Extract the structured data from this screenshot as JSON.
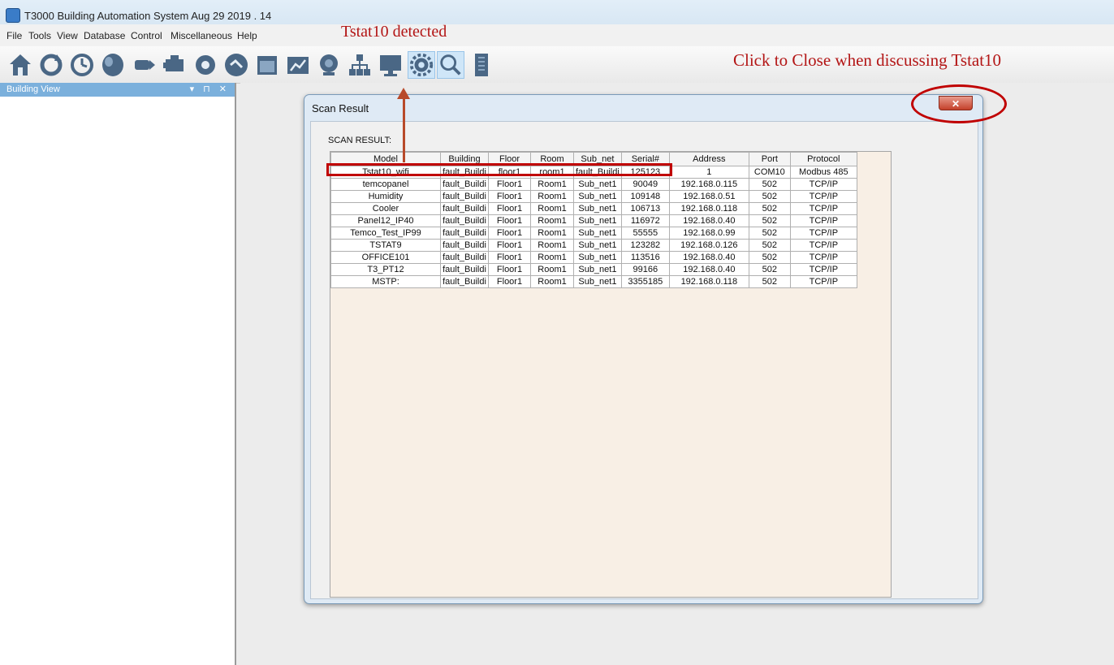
{
  "window": {
    "title": "T3000 Building Automation System   Aug 29 2019  . 14"
  },
  "menu": [
    "File",
    "Tools",
    "View",
    "Database",
    "Control",
    "Miscellaneous",
    "Help"
  ],
  "annotations": {
    "detected": "Tstat10 detected",
    "close_hint": "Click to Close when discussing Tstat10",
    "color": "#b31515"
  },
  "toolbar": {
    "icons": [
      "building-icon",
      "refresh-icon",
      "schedule-icon",
      "input-icon",
      "output-icon",
      "variable-icon",
      "program-icon",
      "controller-icon",
      "calendar-icon",
      "graph-icon",
      "alarm-icon",
      "network-icon",
      "screen-icon",
      "settings-icon",
      "scan-icon",
      "panel-icon"
    ]
  },
  "left_pane": {
    "title": "Building View",
    "controls": "▾ ⊓ ✕"
  },
  "dialog": {
    "title": "Scan Result",
    "close_label": "✕",
    "section_label": "SCAN RESULT:",
    "columns": [
      "Model",
      "Building",
      "Floor",
      "Room",
      "Sub_net",
      "Serial#",
      "Address",
      "Port",
      "Protocol"
    ],
    "rows": [
      [
        "Tstat10_wifi",
        "fault_Buildi",
        "floor1",
        "room1",
        "fault_Buildi",
        "125123",
        "1",
        "COM10",
        "Modbus 485"
      ],
      [
        "temcopanel",
        "fault_Buildi",
        "Floor1",
        "Room1",
        "Sub_net1",
        "90049",
        "192.168.0.115",
        "502",
        "TCP/IP"
      ],
      [
        "Humidity",
        "fault_Buildi",
        "Floor1",
        "Room1",
        "Sub_net1",
        "109148",
        "192.168.0.51",
        "502",
        "TCP/IP"
      ],
      [
        "Cooler",
        "fault_Buildi",
        "Floor1",
        "Room1",
        "Sub_net1",
        "106713",
        "192.168.0.118",
        "502",
        "TCP/IP"
      ],
      [
        "Panel12_IP40",
        "fault_Buildi",
        "Floor1",
        "Room1",
        "Sub_net1",
        "116972",
        "192.168.0.40",
        "502",
        "TCP/IP"
      ],
      [
        "Temco_Test_IP99",
        "fault_Buildi",
        "Floor1",
        "Room1",
        "Sub_net1",
        "55555",
        "192.168.0.99",
        "502",
        "TCP/IP"
      ],
      [
        "TSTAT9",
        "fault_Buildi",
        "Floor1",
        "Room1",
        "Sub_net1",
        "123282",
        "192.168.0.126",
        "502",
        "TCP/IP"
      ],
      [
        "OFFICE101",
        "fault_Buildi",
        "Floor1",
        "Room1",
        "Sub_net1",
        "113516",
        "192.168.0.40",
        "502",
        "TCP/IP"
      ],
      [
        "T3_PT12",
        "fault_Buildi",
        "Floor1",
        "Room1",
        "Sub_net1",
        "99166",
        "192.168.0.40",
        "502",
        "TCP/IP"
      ],
      [
        "MSTP:",
        "fault_Buildi",
        "Floor1",
        "Room1",
        "Sub_net1",
        "3355185",
        "192.168.0.118",
        "502",
        "TCP/IP"
      ]
    ]
  }
}
